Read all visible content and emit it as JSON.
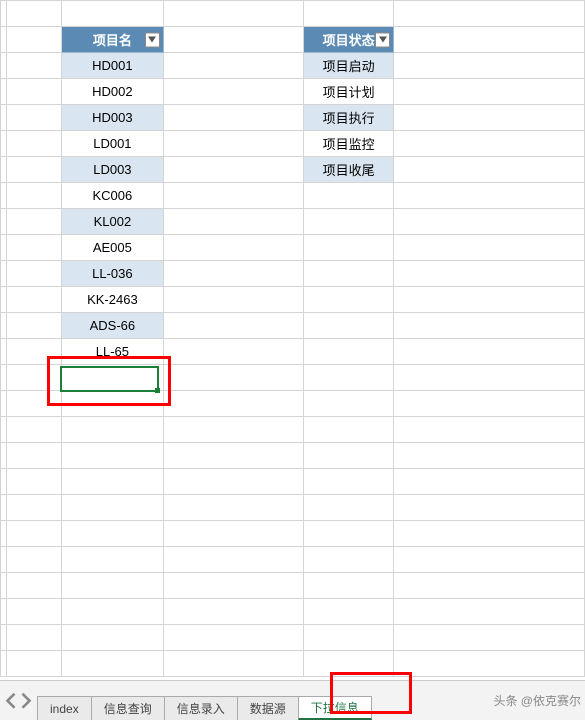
{
  "headers": {
    "project_name": "项目名",
    "project_status": "项目状态"
  },
  "project_names": [
    "HD001",
    "HD002",
    "HD003",
    "LD001",
    "LD003",
    "KC006",
    "KL002",
    "AE005",
    "LL-036",
    "KK-2463",
    "ADS-66",
    "LL-65"
  ],
  "project_statuses": [
    "项目启动",
    "项目计划",
    "项目执行",
    "项目监控",
    "项目收尾"
  ],
  "sheet_tabs": {
    "t0": "index",
    "t1": "信息查询",
    "t2": "信息录入",
    "t3": "数据源",
    "t4": "下拉信息"
  },
  "watermark": "头条 @依克赛尔"
}
